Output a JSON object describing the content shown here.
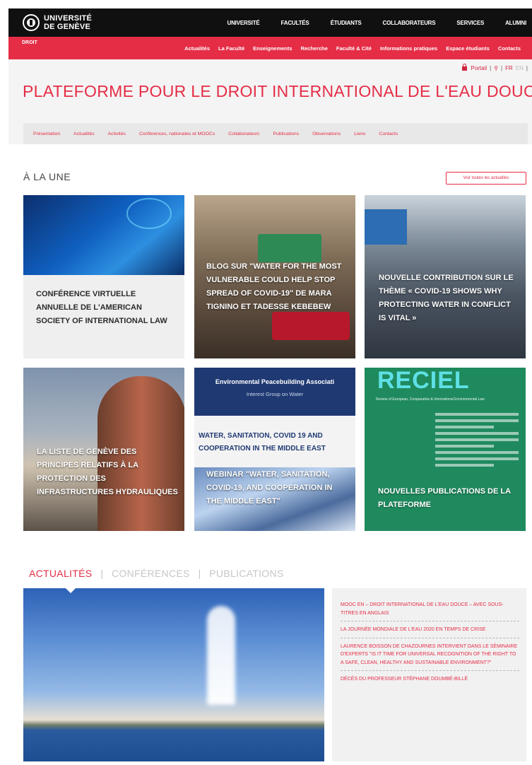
{
  "topbar": {
    "logo_line1": "UNIVERSITÉ",
    "logo_line2": "DE GENÈVE",
    "nav": [
      "UNIVERSITÉ",
      "FACULTÉS",
      "ÉTUDIANTS",
      "COLLABORATEURS",
      "SERVICES",
      "ALUMNI"
    ]
  },
  "faculty_bar": {
    "label": "DROIT",
    "nav": [
      "Actualités",
      "La Faculté",
      "Enseignements",
      "Recherche",
      "Faculté & Cité",
      "Informations pratiques",
      "Espace étudiants",
      "Contacts"
    ]
  },
  "utility": {
    "portal": "Portail",
    "separator": "|",
    "lang_fr": "FR",
    "lang_en": "EN"
  },
  "site_title": "PLATEFORME POUR LE DROIT INTERNATIONAL DE L'EAU DOUCE",
  "section_nav": [
    "Présentation",
    "Actualités",
    "Activités",
    "Conférences, nationales et MOOCs",
    "Collaborateurs",
    "Publications",
    "Observations",
    "Liens",
    "Contacts"
  ],
  "une": {
    "title": "À LA UNE",
    "all_button": "Voir toutes les actualités"
  },
  "cards": [
    {
      "text": "CONFÉRENCE VIRTUELLE ANNUELLE DE L'AMERICAN SOCIETY OF INTERNATIONAL LAW"
    },
    {
      "text": "BLOG SUR \"WATER FOR THE MOST VULNERABLE COULD HELP STOP SPREAD OF COVID-19\" DE MARA TIGNINO ET TADESSE KEBEBEW"
    },
    {
      "text": "NOUVELLE CONTRIBUTION SUR LE THÈME « COVID-19 SHOWS WHY PROTECTING WATER IN CONFLICT IS VITAL »"
    },
    {
      "text": "LA LISTE DE GENÈVE DES PRINCIPES RELATIFS À LA PROTECTION DES INFRASTRUCTURES HYDRAULIQUES"
    },
    {
      "banner_title": "Environmental Peacebuilding Associati",
      "banner_sub": "Interest Group on Water",
      "mid_text": "WATER, SANITATION, COVID 19 AND COOPERATION IN THE MIDDLE EAST",
      "text": "WEBINAR \"WATER, SANITATION, COVID-19, AND COOPERATION IN THE MIDDLE EAST\""
    },
    {
      "logo_text": "RECIEL",
      "sub_text": "Review of European, Comparative & International Environmental Law",
      "text": "NOUVELLES PUBLICATIONS DE LA PLATEFORME"
    }
  ],
  "tabs": {
    "items": [
      "ACTUALITÉS",
      "CONFÉRENCES",
      "PUBLICATIONS"
    ],
    "separator": "|"
  },
  "news": [
    "MOOC EN – DROIT INTERNATIONAL DE L'EAU DOUCE – AVEC SOUS-TITRES EN ANGLAIS",
    "LA JOURNÉE MONDIALE DE L'EAU 2020 EN TEMPS DE CRISE",
    "LAURENCE BOISSON DE CHAZOURNES INTERVIENT DANS LE SÉMINAIRE D'EXPERTS \"IS IT TIME FOR UNIVERSAL RECOGNITION OF THE RIGHT TO A SAFE, CLEAN, HEALTHY AND SUSTAINABLE ENVIRONMENT?\"",
    "DÉCÈS DU PROFESSEUR STÉPHANE DOUMBÉ-BILLÉ"
  ],
  "colors": {
    "accent": "#e52d46",
    "topbar": "#101010",
    "banner_blue": "#1f3973",
    "reciel_green": "#1f8a5e"
  }
}
